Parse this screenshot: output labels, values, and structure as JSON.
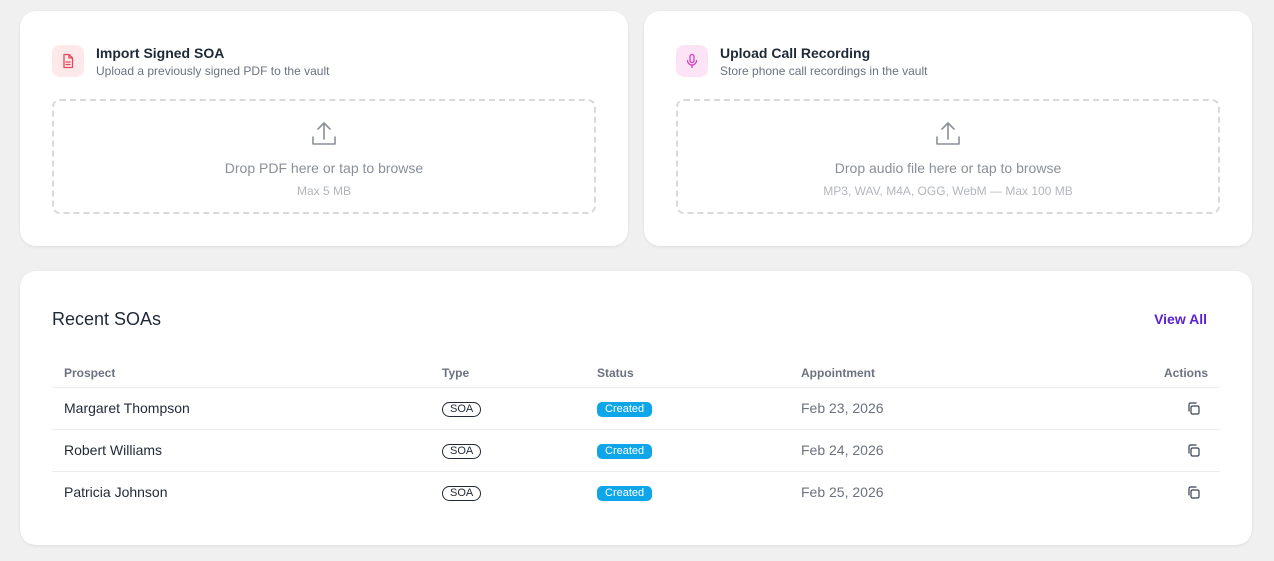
{
  "colors": {
    "page_bg": "#f0f0f0",
    "card_bg": "#ffffff",
    "accent": "#5b21d6",
    "status_created": "#0ea5e9",
    "pdf_icon": "#e5485d",
    "mic_icon": "#d63cc3"
  },
  "import_soa": {
    "icon": "pdf-file-icon",
    "title": "Import Signed SOA",
    "subtitle": "Upload a previously signed PDF to the vault",
    "drop_icon": "upload-icon",
    "drop_text": "Drop PDF here or tap to browse",
    "drop_hint": "Max 5 MB"
  },
  "call_recording": {
    "icon": "microphone-icon",
    "title": "Upload Call Recording",
    "subtitle": "Store phone call recordings in the vault",
    "drop_icon": "upload-icon",
    "drop_text": "Drop audio file here or tap to browse",
    "drop_hint": "MP3, WAV, M4A, OGG, WebM — Max 100 MB"
  },
  "recent": {
    "title": "Recent SOAs",
    "view_all": "View All",
    "columns": {
      "prospect": "Prospect",
      "type": "Type",
      "status": "Status",
      "appointment": "Appointment",
      "actions": "Actions"
    },
    "rows": [
      {
        "prospect": "Margaret Thompson",
        "type": "SOA",
        "status": "Created",
        "appointment": "Feb 23, 2026",
        "action_icon": "copy-icon"
      },
      {
        "prospect": "Robert Williams",
        "type": "SOA",
        "status": "Created",
        "appointment": "Feb 24, 2026",
        "action_icon": "copy-icon"
      },
      {
        "prospect": "Patricia Johnson",
        "type": "SOA",
        "status": "Created",
        "appointment": "Feb 25, 2026",
        "action_icon": "copy-icon"
      }
    ]
  }
}
